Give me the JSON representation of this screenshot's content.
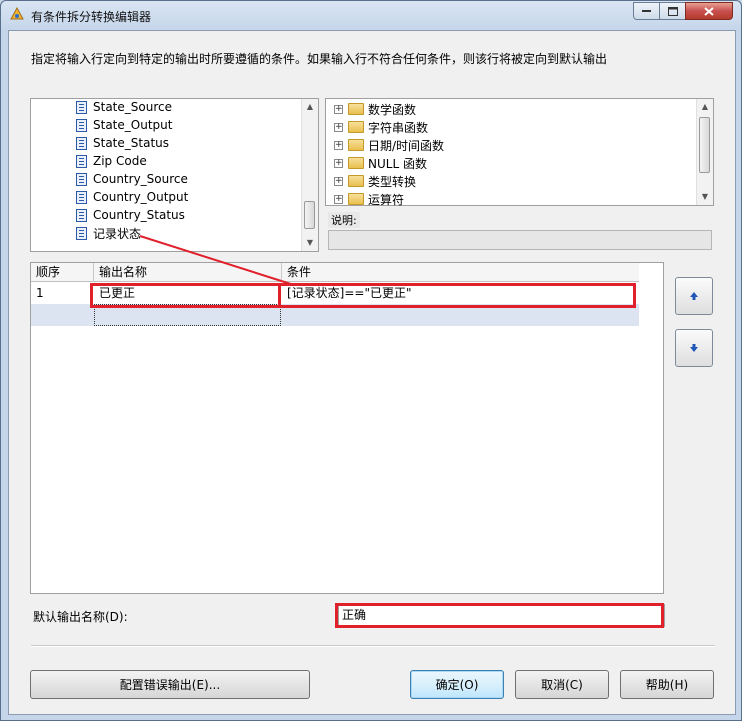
{
  "window": {
    "title": "有条件拆分转换编辑器"
  },
  "description": "指定将输入行定向到特定的输出时所要遵循的条件。如果输入行不符合任何条件，则该行将被定向到默认输出",
  "columns": [
    {
      "label": "State_Source"
    },
    {
      "label": "State_Output"
    },
    {
      "label": "State_Status"
    },
    {
      "label": "Zip Code"
    },
    {
      "label": "Country_Source"
    },
    {
      "label": "Country_Output"
    },
    {
      "label": "Country_Status"
    },
    {
      "label": "记录状态"
    }
  ],
  "functions": [
    {
      "label": "数学函数"
    },
    {
      "label": "字符串函数"
    },
    {
      "label": "日期/时间函数"
    },
    {
      "label": "NULL 函数"
    },
    {
      "label": "类型转换"
    },
    {
      "label": "运算符"
    }
  ],
  "function_description": {
    "label": "说明:",
    "value": ""
  },
  "grid": {
    "headers": [
      "顺序",
      "输出名称",
      "条件"
    ],
    "rows": [
      {
        "order": "1",
        "name": "已更正",
        "condition": "[记录状态]==\"已更正\""
      }
    ]
  },
  "default_output": {
    "label": "默认输出名称(D):",
    "value": "正确"
  },
  "buttons": {
    "configure_error": "配置错误输出(E)...",
    "ok": "确定(O)",
    "cancel": "取消(C)",
    "help": "帮助(H)"
  },
  "colors": {
    "highlight": "#e0202a",
    "selection_row": "#dbe4f0"
  }
}
